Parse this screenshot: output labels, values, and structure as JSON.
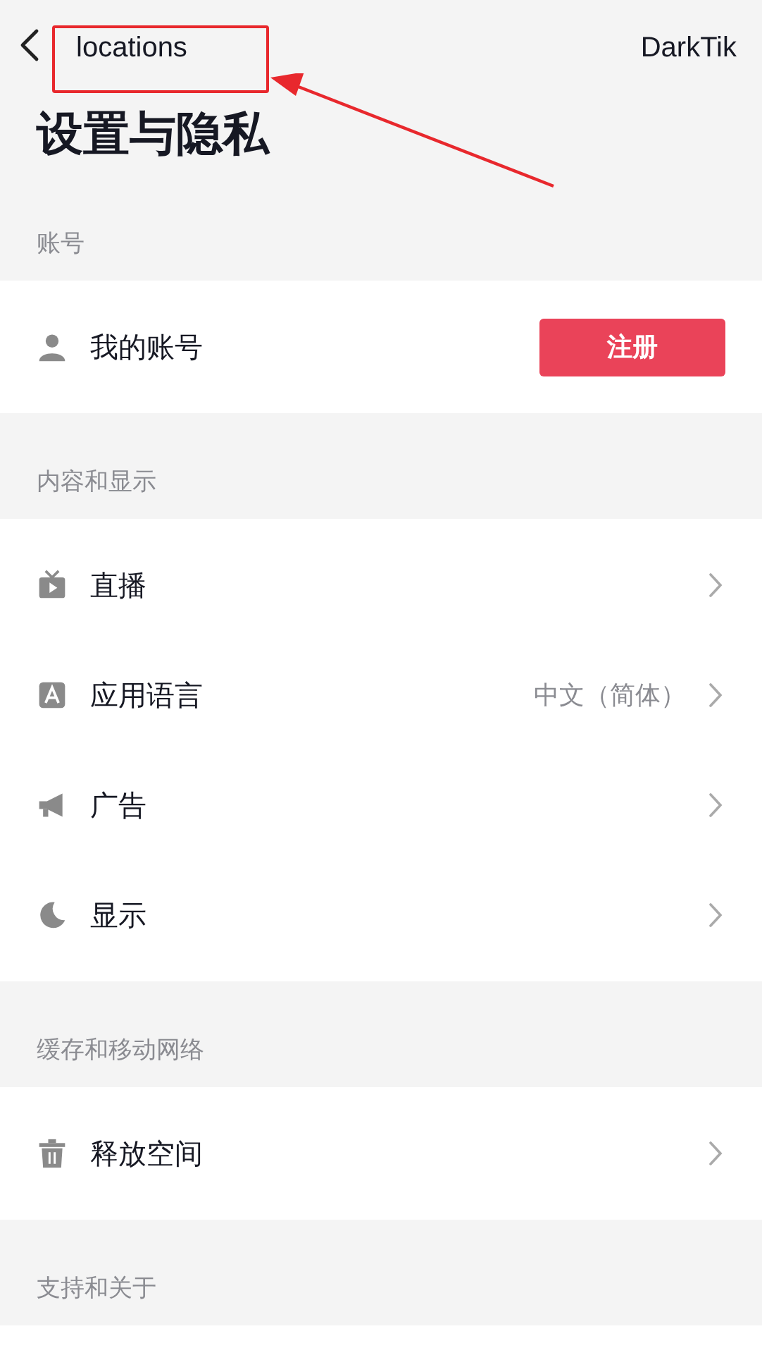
{
  "nav": {
    "title": "locations",
    "right": "DarkTik"
  },
  "title": "设置与隐私",
  "sections": [
    {
      "header": "账号",
      "rows": [
        {
          "kind": "button",
          "label": "我的账号",
          "button": "注册"
        }
      ]
    },
    {
      "header": "内容和显示",
      "rows": [
        {
          "kind": "link",
          "label": "直播"
        },
        {
          "kind": "link",
          "label": "应用语言",
          "value": "中文（简体）"
        },
        {
          "kind": "link",
          "label": "广告"
        },
        {
          "kind": "link",
          "label": "显示"
        }
      ]
    },
    {
      "header": "缓存和移动网络",
      "rows": [
        {
          "kind": "link",
          "label": "释放空间"
        }
      ]
    },
    {
      "header": "支持和关于"
    }
  ]
}
